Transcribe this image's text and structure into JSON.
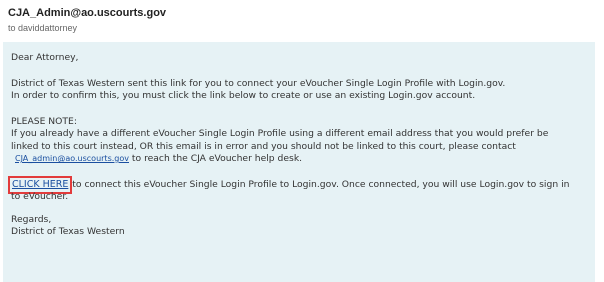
{
  "header": {
    "sender": "CJA_Admin@ao.uscourts.gov",
    "recipient": "to daviddattorney"
  },
  "body": {
    "greeting": "Dear Attorney,",
    "intro_line1": "District of Texas Western  sent this link for you to connect your eVoucher Single Login Profile with Login.gov.",
    "intro_line2": "In order to confirm this, you must click the link below to create or use an existing Login.gov account.",
    "note_heading": "PLEASE NOTE:",
    "note_line1": "If you already have a different eVoucher Single Login Profile using a different email address that you would prefer be",
    "note_line2": "linked to this court instead, OR this email is in error and you should not be linked to this court, please contact",
    "help_email": "CJA_admin@ao.uscourts.gov",
    "help_suffix": " to reach the CJA eVoucher help desk.",
    "click_here_label": "CLICK HERE",
    "connect_line1": " to connect this eVoucher Single Login Profile to Login.gov. Once connected, you will use Login.gov to sign in",
    "connect_line2": "to eVoucher.",
    "regards": "Regards,",
    "signature": "District of Texas Western"
  },
  "colors": {
    "body_background": "#e6f2f5",
    "link": "#1a4fa0",
    "highlight_box": "#e23b3b"
  }
}
